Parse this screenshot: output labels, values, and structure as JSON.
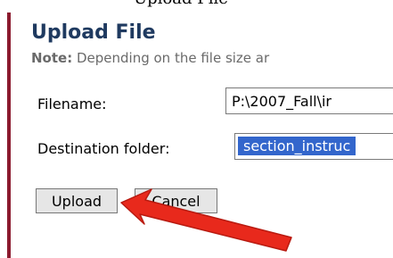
{
  "page": {
    "top_text": "Upload File"
  },
  "dialog": {
    "title": "Upload File",
    "note_label": "Note:",
    "note_text": " Depending on the file size ar"
  },
  "form": {
    "filename_label": "Filename:",
    "filename_value": "P:\\2007_Fall\\ir",
    "destination_label": "Destination folder:",
    "destination_value": "section_instruc"
  },
  "buttons": {
    "upload": "Upload",
    "cancel": "Cancel"
  },
  "annotation": {
    "arrow_color": "#e8291c",
    "arrow_icon": "red-arrow-icon"
  },
  "colors": {
    "border_accent": "#8b1a2e",
    "title": "#1f3a60",
    "selection": "#3366cc"
  }
}
